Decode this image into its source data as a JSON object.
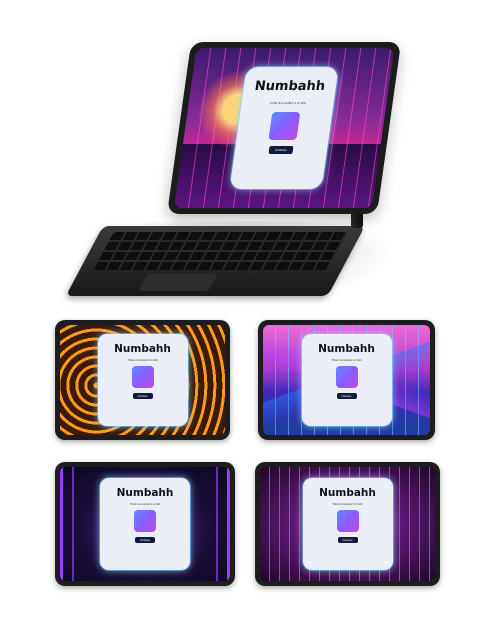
{
  "app": {
    "title": "Numbahh",
    "subtitle": "Think of a number 1 to 100",
    "continue_label": "Continue"
  },
  "mockups": [
    {
      "scene": "synthwave-sunset-palms"
    },
    {
      "scene": "orange-neon-tunnel"
    },
    {
      "scene": "neon-wireframe-mountains"
    },
    {
      "scene": "purple-neon-corridor"
    },
    {
      "scene": "pink-server-room"
    }
  ],
  "colors": {
    "card_bg": "#eceef7",
    "card_glow": "#8cdcff",
    "button_bg": "#111a3a",
    "art_gradient_start": "#5a8cff",
    "art_gradient_end": "#c04ae0"
  }
}
